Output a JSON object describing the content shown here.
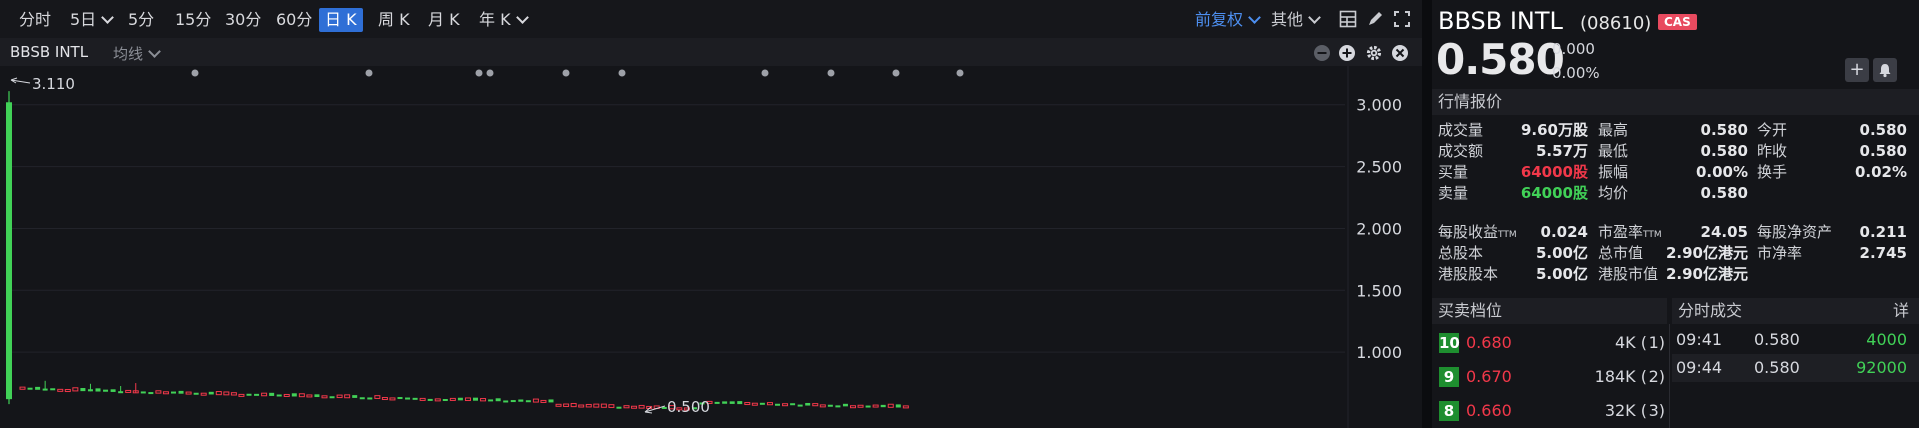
{
  "periods": [
    {
      "label": "分时",
      "dropdown": false,
      "active": false
    },
    {
      "label": "5日",
      "dropdown": true,
      "active": false
    },
    {
      "label": "5分",
      "dropdown": false,
      "active": false
    },
    {
      "label": "15分",
      "dropdown": false,
      "active": false
    },
    {
      "label": "30分",
      "dropdown": false,
      "active": false
    },
    {
      "label": "60分",
      "dropdown": false,
      "active": false
    },
    {
      "label": "日 K",
      "dropdown": false,
      "active": true
    },
    {
      "label": "周 K",
      "dropdown": false,
      "active": false
    },
    {
      "label": "月 K",
      "dropdown": false,
      "active": false
    },
    {
      "label": "年 K",
      "dropdown": true,
      "active": false
    }
  ],
  "toolbar": {
    "adjust_label": "前复权",
    "other_label": "其他",
    "icons": [
      "layout-icon",
      "draw-icon",
      "fullscreen-icon"
    ]
  },
  "chart_header": {
    "symbol": "BBSB INTL",
    "ma_label": "均线",
    "icons": [
      "zoom-out-icon",
      "zoom-in-icon",
      "settings-icon",
      "close-icon"
    ]
  },
  "chart_data": {
    "type": "candlestick",
    "y_ticks": [
      "3.000",
      "2.500",
      "2.000",
      "1.500",
      "1.000"
    ],
    "ylim": [
      0.5,
      3.2
    ],
    "high_marker": "3.110",
    "low_marker": "0.500",
    "colors": {
      "up": "#f2384a",
      "down": "#41d157",
      "grid": "#22232a",
      "dot": "#9ea1a8"
    },
    "event_dot_count": 10
  },
  "quote": {
    "name": "BBSB INTL",
    "code": "(08610)",
    "badge": "CAS",
    "price": "0.580",
    "change": "0.000",
    "change_pct": "0.00%",
    "add_icon": "+",
    "section_title": "行情报价",
    "rows": [
      [
        {
          "k": "成交量",
          "v": "9.60万股"
        },
        {
          "k": "最高",
          "v": "0.580"
        },
        {
          "k": "今开",
          "v": "0.580"
        }
      ],
      [
        {
          "k": "成交额",
          "v": "5.57万"
        },
        {
          "k": "最低",
          "v": "0.580"
        },
        {
          "k": "昨收",
          "v": "0.580"
        }
      ],
      [
        {
          "k": "买量",
          "v": "64000股",
          "color": "red"
        },
        {
          "k": "振幅",
          "v": "0.00%"
        },
        {
          "k": "换手",
          "v": "0.02%"
        }
      ],
      [
        {
          "k": "卖量",
          "v": "64000股",
          "color": "green"
        },
        {
          "k": "均价",
          "v": "0.580"
        },
        null
      ]
    ],
    "rows2": [
      [
        {
          "k": "每股收益",
          "sub": "TTM",
          "v": "0.024"
        },
        {
          "k": "市盈率",
          "sub": "TTM",
          "v": "24.05"
        },
        {
          "k": "每股净资产",
          "v": "0.211"
        }
      ],
      [
        {
          "k": "总股本",
          "v": "5.00亿"
        },
        {
          "k": "总市值",
          "v": "2.90亿港元"
        },
        {
          "k": "市净率",
          "v": "2.745"
        }
      ],
      [
        {
          "k": "港股股本",
          "v": "5.00亿"
        },
        {
          "k": "港股市值",
          "v": "2.90亿港元"
        },
        null
      ]
    ]
  },
  "depth": {
    "title": "买卖档位",
    "rows": [
      {
        "level": "10",
        "price": "0.680",
        "vol": "4K (",
        "count": "1)"
      },
      {
        "level": "9",
        "price": "0.670",
        "vol": "184K (",
        "count": "2)"
      },
      {
        "level": "8",
        "price": "0.660",
        "vol": "32K (",
        "count": "3)"
      }
    ]
  },
  "ticks": {
    "title": "分时成交",
    "detail": "详",
    "rows": [
      {
        "time": "09:41",
        "price": "0.580",
        "vol": "4000"
      },
      {
        "time": "09:44",
        "price": "0.580",
        "vol": "92000"
      }
    ]
  }
}
